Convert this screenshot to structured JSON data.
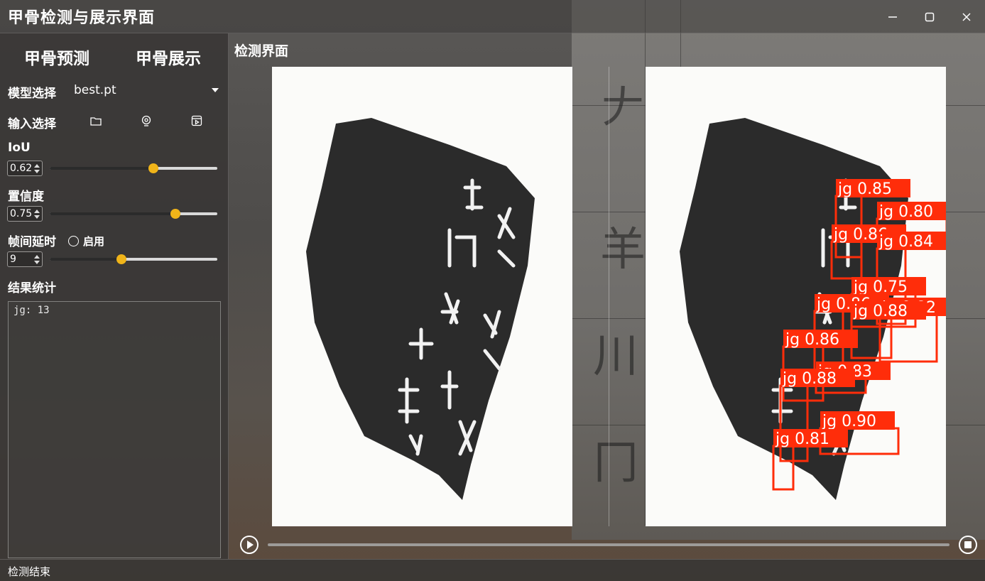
{
  "window": {
    "title": "甲骨检测与展示界面",
    "controls": [
      "minimize",
      "maximize",
      "close"
    ]
  },
  "sidebar": {
    "tabs": [
      {
        "label": "甲骨预测"
      },
      {
        "label": "甲骨展示"
      }
    ],
    "model_select": {
      "label": "模型选择",
      "value": "best.pt"
    },
    "input_select": {
      "label": "输入选择",
      "icons": [
        "folder-icon",
        "webcam-icon",
        "video-icon"
      ]
    },
    "iou": {
      "label": "IoU",
      "value": "0.62",
      "level": 0.62
    },
    "confidence": {
      "label": "置信度",
      "value": "0.75",
      "level": 0.75
    },
    "frame_delay": {
      "label": "帧间延时",
      "radio_label": "启用",
      "value": "9",
      "level": 0.43
    },
    "results": {
      "label": "结果统计",
      "text": "jg: 13"
    }
  },
  "main": {
    "title": "检测界面",
    "detections": [
      {
        "label": "jg 0.85"
      },
      {
        "label": "jg 0.80"
      },
      {
        "label": "jg 0.86"
      },
      {
        "label": "jg 0.84"
      },
      {
        "label": "jg 0.75"
      },
      {
        "label": "jg 0.86"
      },
      {
        "label": "jg 0.82"
      },
      {
        "label": "jg 0.88"
      },
      {
        "label": "jg 0.86"
      },
      {
        "label": "jg 0.83"
      },
      {
        "label": "jg 0.88"
      },
      {
        "label": "jg 0.90"
      },
      {
        "label": "jg 0.81"
      }
    ]
  },
  "player": {
    "progress": 0
  },
  "status": {
    "text": "检测结束"
  },
  "colors": {
    "accent": "#f0b419",
    "detection": "#ff2d0a"
  }
}
